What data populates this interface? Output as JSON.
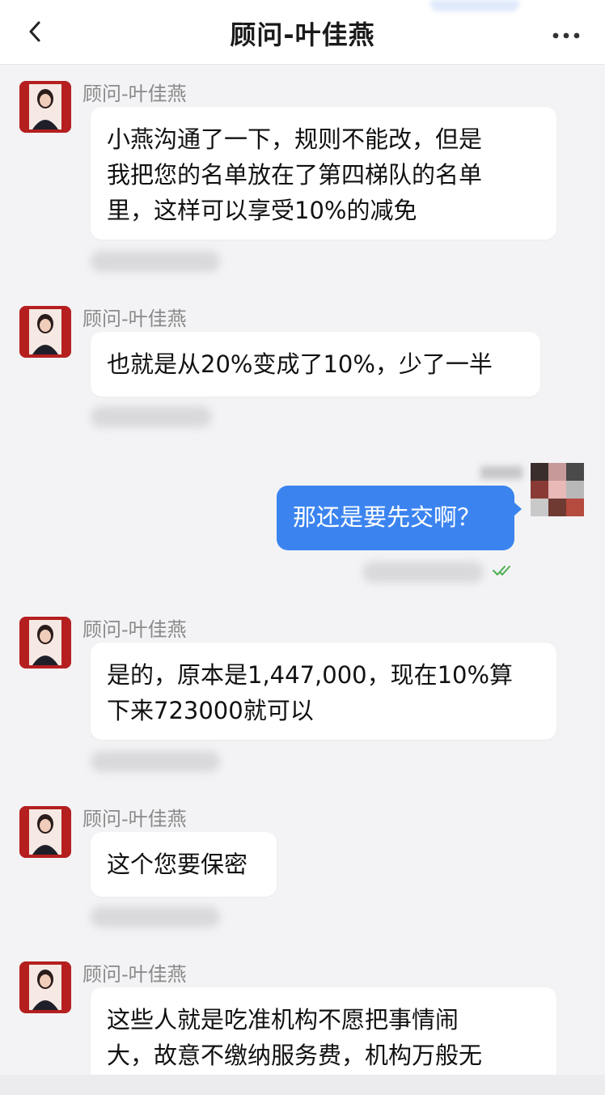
{
  "header": {
    "title": "顾问-叶佳燕"
  },
  "messages": [
    {
      "sender": "顾问-叶佳燕",
      "lines": [
        "小燕沟通了一下，规则不能改，但是",
        "我把您的名单放在了第四梯队的名单",
        "里，这样可以享受10%的减免"
      ]
    },
    {
      "sender": "顾问-叶佳燕",
      "lines": [
        "也就是从20%变成了10%，少了一半"
      ]
    },
    {
      "lines": [
        "那还是要先交啊？"
      ]
    },
    {
      "sender": "顾问-叶佳燕",
      "lines": [
        "是的，原本是1,447,000，现在10%算",
        "下来723000就可以"
      ]
    },
    {
      "sender": "顾问-叶佳燕",
      "lines": [
        "这个您要保密"
      ]
    },
    {
      "sender": "顾问-叶佳燕",
      "lines": [
        "这些人就是吃准机构不愿把事情闹",
        "大，故意不缴纳服务费，机构万般无"
      ]
    }
  ],
  "colors": {
    "outgoing_bubble": "#3b84f0",
    "avatar_bg": "#b51f1f",
    "read_check": "#4caf50"
  },
  "icons": [
    "back-arrow-icon",
    "more-dots-icon",
    "read-check-icon"
  ]
}
